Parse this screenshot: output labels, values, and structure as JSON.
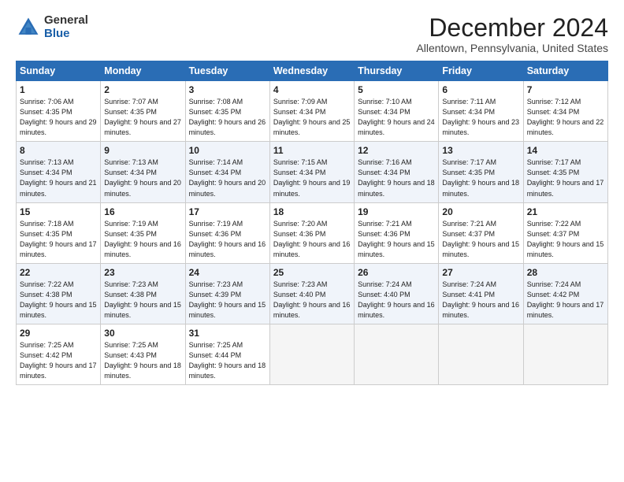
{
  "logo": {
    "general": "General",
    "blue": "Blue"
  },
  "title": "December 2024",
  "subtitle": "Allentown, Pennsylvania, United States",
  "days_header": [
    "Sunday",
    "Monday",
    "Tuesday",
    "Wednesday",
    "Thursday",
    "Friday",
    "Saturday"
  ],
  "weeks": [
    [
      {
        "day": 1,
        "sunrise": "7:06 AM",
        "sunset": "4:35 PM",
        "daylight": "9 hours and 29 minutes."
      },
      {
        "day": 2,
        "sunrise": "7:07 AM",
        "sunset": "4:35 PM",
        "daylight": "9 hours and 27 minutes."
      },
      {
        "day": 3,
        "sunrise": "7:08 AM",
        "sunset": "4:35 PM",
        "daylight": "9 hours and 26 minutes."
      },
      {
        "day": 4,
        "sunrise": "7:09 AM",
        "sunset": "4:34 PM",
        "daylight": "9 hours and 25 minutes."
      },
      {
        "day": 5,
        "sunrise": "7:10 AM",
        "sunset": "4:34 PM",
        "daylight": "9 hours and 24 minutes."
      },
      {
        "day": 6,
        "sunrise": "7:11 AM",
        "sunset": "4:34 PM",
        "daylight": "9 hours and 23 minutes."
      },
      {
        "day": 7,
        "sunrise": "7:12 AM",
        "sunset": "4:34 PM",
        "daylight": "9 hours and 22 minutes."
      }
    ],
    [
      {
        "day": 8,
        "sunrise": "7:13 AM",
        "sunset": "4:34 PM",
        "daylight": "9 hours and 21 minutes."
      },
      {
        "day": 9,
        "sunrise": "7:13 AM",
        "sunset": "4:34 PM",
        "daylight": "9 hours and 20 minutes."
      },
      {
        "day": 10,
        "sunrise": "7:14 AM",
        "sunset": "4:34 PM",
        "daylight": "9 hours and 20 minutes."
      },
      {
        "day": 11,
        "sunrise": "7:15 AM",
        "sunset": "4:34 PM",
        "daylight": "9 hours and 19 minutes."
      },
      {
        "day": 12,
        "sunrise": "7:16 AM",
        "sunset": "4:34 PM",
        "daylight": "9 hours and 18 minutes."
      },
      {
        "day": 13,
        "sunrise": "7:17 AM",
        "sunset": "4:35 PM",
        "daylight": "9 hours and 18 minutes."
      },
      {
        "day": 14,
        "sunrise": "7:17 AM",
        "sunset": "4:35 PM",
        "daylight": "9 hours and 17 minutes."
      }
    ],
    [
      {
        "day": 15,
        "sunrise": "7:18 AM",
        "sunset": "4:35 PM",
        "daylight": "9 hours and 17 minutes."
      },
      {
        "day": 16,
        "sunrise": "7:19 AM",
        "sunset": "4:35 PM",
        "daylight": "9 hours and 16 minutes."
      },
      {
        "day": 17,
        "sunrise": "7:19 AM",
        "sunset": "4:36 PM",
        "daylight": "9 hours and 16 minutes."
      },
      {
        "day": 18,
        "sunrise": "7:20 AM",
        "sunset": "4:36 PM",
        "daylight": "9 hours and 16 minutes."
      },
      {
        "day": 19,
        "sunrise": "7:21 AM",
        "sunset": "4:36 PM",
        "daylight": "9 hours and 15 minutes."
      },
      {
        "day": 20,
        "sunrise": "7:21 AM",
        "sunset": "4:37 PM",
        "daylight": "9 hours and 15 minutes."
      },
      {
        "day": 21,
        "sunrise": "7:22 AM",
        "sunset": "4:37 PM",
        "daylight": "9 hours and 15 minutes."
      }
    ],
    [
      {
        "day": 22,
        "sunrise": "7:22 AM",
        "sunset": "4:38 PM",
        "daylight": "9 hours and 15 minutes."
      },
      {
        "day": 23,
        "sunrise": "7:23 AM",
        "sunset": "4:38 PM",
        "daylight": "9 hours and 15 minutes."
      },
      {
        "day": 24,
        "sunrise": "7:23 AM",
        "sunset": "4:39 PM",
        "daylight": "9 hours and 15 minutes."
      },
      {
        "day": 25,
        "sunrise": "7:23 AM",
        "sunset": "4:40 PM",
        "daylight": "9 hours and 16 minutes."
      },
      {
        "day": 26,
        "sunrise": "7:24 AM",
        "sunset": "4:40 PM",
        "daylight": "9 hours and 16 minutes."
      },
      {
        "day": 27,
        "sunrise": "7:24 AM",
        "sunset": "4:41 PM",
        "daylight": "9 hours and 16 minutes."
      },
      {
        "day": 28,
        "sunrise": "7:24 AM",
        "sunset": "4:42 PM",
        "daylight": "9 hours and 17 minutes."
      }
    ],
    [
      {
        "day": 29,
        "sunrise": "7:25 AM",
        "sunset": "4:42 PM",
        "daylight": "9 hours and 17 minutes."
      },
      {
        "day": 30,
        "sunrise": "7:25 AM",
        "sunset": "4:43 PM",
        "daylight": "9 hours and 18 minutes."
      },
      {
        "day": 31,
        "sunrise": "7:25 AM",
        "sunset": "4:44 PM",
        "daylight": "9 hours and 18 minutes."
      },
      null,
      null,
      null,
      null
    ]
  ]
}
